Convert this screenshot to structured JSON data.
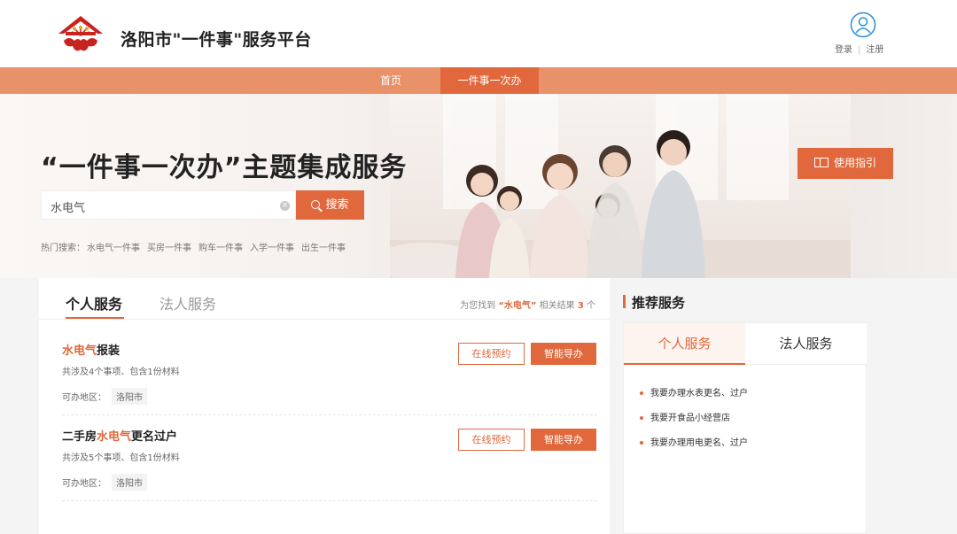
{
  "header": {
    "site_title": "洛阳市\"一件事\"服务平台",
    "login": "登录",
    "register": "注册",
    "separator": "|"
  },
  "nav": {
    "home": "首页",
    "active": "一件事一次办"
  },
  "banner": {
    "title": "“一件事一次办”主题集成服务",
    "search_value": "水电气",
    "search_button": "搜索",
    "hot_label": "热门搜索：",
    "hot_items": [
      "水电气一件事",
      "买房一件事",
      "购车一件事",
      "入学一件事",
      "出生一件事"
    ],
    "guide_button": "使用指引"
  },
  "main": {
    "tabs": [
      "个人服务",
      "法人服务"
    ],
    "summary": {
      "prefix": "为您找到",
      "keyword": "“水电气”",
      "middle": "相关结果",
      "count": "3",
      "suffix": "个"
    },
    "rows": [
      {
        "title_hl": "水电气",
        "title_rest": "报装",
        "sub": "共涉及4个事项、包含1份材料",
        "area_label": "可办地区：",
        "area": "洛阳市",
        "btn1": "在线预约",
        "btn2": "智能导办"
      },
      {
        "title_pre": "二手房",
        "title_hl": "水电气",
        "title_rest": "更名过户",
        "sub": "共涉及5个事项、包含1份材料",
        "area_label": "可办地区：",
        "area": "洛阳市",
        "btn1": "在线预约",
        "btn2": "智能导办"
      }
    ]
  },
  "recommend": {
    "title": "推荐服务",
    "tabs": [
      "个人服务",
      "法人服务"
    ],
    "items": [
      "我要办理水表更名、过户",
      "我要开食品小经营店",
      "我要办理用电更名、过户"
    ]
  },
  "colors": {
    "accent": "#e0683c",
    "nav": "#e9926a"
  }
}
